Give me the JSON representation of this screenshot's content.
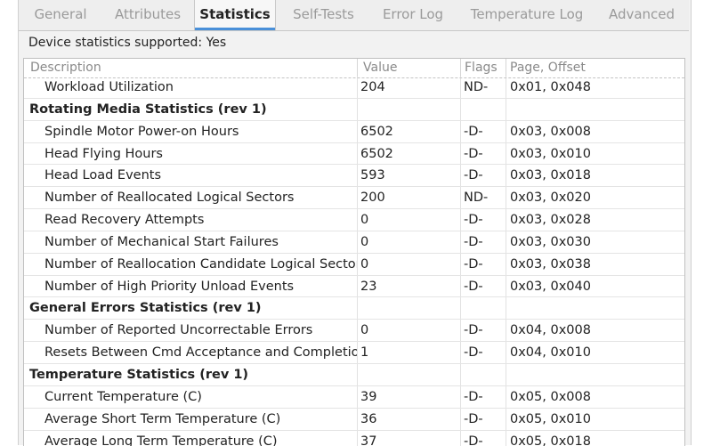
{
  "tabs": [
    {
      "label": "General",
      "active": false
    },
    {
      "label": "Attributes",
      "active": false
    },
    {
      "label": "Statistics",
      "active": true
    },
    {
      "label": "Self-Tests",
      "active": false
    },
    {
      "label": "Error Log",
      "active": false
    },
    {
      "label": "Temperature Log",
      "active": false
    },
    {
      "label": "Advanced",
      "active": false
    }
  ],
  "supported_text": "Device statistics supported: Yes",
  "table": {
    "headers": {
      "description": "Description",
      "value": "Value",
      "flags": "Flags",
      "page_offset": "Page, Offset"
    },
    "rows": [
      {
        "group": false,
        "description": "Workload Utilization",
        "value": "204",
        "flags": "ND-",
        "page_offset": "0x01, 0x048"
      },
      {
        "group": true,
        "description": "Rotating Media Statistics (rev 1)",
        "value": "",
        "flags": "",
        "page_offset": ""
      },
      {
        "group": false,
        "description": "Spindle Motor Power-on Hours",
        "value": "6502",
        "flags": "-D-",
        "page_offset": "0x03, 0x008"
      },
      {
        "group": false,
        "description": "Head Flying Hours",
        "value": "6502",
        "flags": "-D-",
        "page_offset": "0x03, 0x010"
      },
      {
        "group": false,
        "description": "Head Load Events",
        "value": "593",
        "flags": "-D-",
        "page_offset": "0x03, 0x018"
      },
      {
        "group": false,
        "description": "Number of Reallocated Logical Sectors",
        "value": "200",
        "flags": "ND-",
        "page_offset": "0x03, 0x020"
      },
      {
        "group": false,
        "description": "Read Recovery Attempts",
        "value": "0",
        "flags": "-D-",
        "page_offset": "0x03, 0x028"
      },
      {
        "group": false,
        "description": "Number of Mechanical Start Failures",
        "value": "0",
        "flags": "-D-",
        "page_offset": "0x03, 0x030"
      },
      {
        "group": false,
        "description": "Number of Reallocation Candidate Logical Sectors",
        "value": "0",
        "flags": "-D-",
        "page_offset": "0x03, 0x038"
      },
      {
        "group": false,
        "description": "Number of High Priority Unload Events",
        "value": "23",
        "flags": "-D-",
        "page_offset": "0x03, 0x040"
      },
      {
        "group": true,
        "description": "General Errors Statistics (rev 1)",
        "value": "",
        "flags": "",
        "page_offset": ""
      },
      {
        "group": false,
        "description": "Number of Reported Uncorrectable Errors",
        "value": "0",
        "flags": "-D-",
        "page_offset": "0x04, 0x008"
      },
      {
        "group": false,
        "description": "Resets Between Cmd Acceptance and Completion",
        "value": "1",
        "flags": "-D-",
        "page_offset": "0x04, 0x010"
      },
      {
        "group": true,
        "description": "Temperature Statistics (rev 1)",
        "value": "",
        "flags": "",
        "page_offset": ""
      },
      {
        "group": false,
        "description": "Current Temperature (C)",
        "value": "39",
        "flags": "-D-",
        "page_offset": "0x05, 0x008"
      },
      {
        "group": false,
        "description": "Average Short Term Temperature (C)",
        "value": "36",
        "flags": "-D-",
        "page_offset": "0x05, 0x010"
      },
      {
        "group": false,
        "description": "Average Long Term Temperature (C)",
        "value": "37",
        "flags": "-D-",
        "page_offset": "0x05, 0x018"
      }
    ]
  },
  "colors": {
    "accent": "#4a90d9",
    "inactive_tab_text": "#9a9a9a",
    "header_text": "#8a8a8a"
  }
}
